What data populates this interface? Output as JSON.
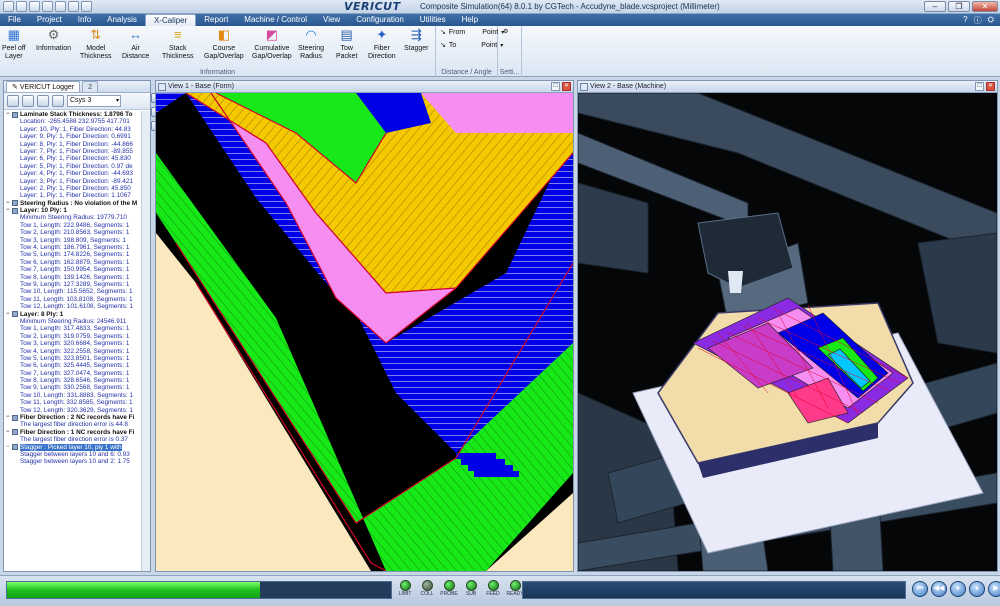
{
  "titlebar": {
    "logo": "VERICUT",
    "title": "Composite Simulation(64)  8.0.1 by CGTech - Accudyne_blade.vcsproject (Millimeter)",
    "controls": [
      "–",
      "❐",
      "✕"
    ]
  },
  "menu": {
    "items": [
      {
        "label": "File"
      },
      {
        "label": "Project"
      },
      {
        "label": "Info"
      },
      {
        "label": "Analysis"
      },
      {
        "label": "X-Caliper",
        "active": true
      },
      {
        "label": "Report"
      },
      {
        "label": "Machine / Control"
      },
      {
        "label": "View"
      },
      {
        "label": "Configuration"
      },
      {
        "label": "Utilities"
      },
      {
        "label": "Help"
      }
    ],
    "right": [
      "?",
      "ⓘ",
      "⛭"
    ]
  },
  "ribbon": {
    "buttons": [
      {
        "label": "Peel off\nLayer",
        "icon": "peel-off-icon"
      },
      {
        "label": "Information",
        "icon": "information-icon"
      },
      {
        "label": "Model\nThickness",
        "icon": "model-thickness-icon"
      },
      {
        "label": "Air\nDistance",
        "icon": "air-distance-icon"
      },
      {
        "label": "Stack\nThickness",
        "icon": "stack-thickness-icon"
      },
      {
        "label": "Course\nGap/Overlap",
        "icon": "course-gap-icon"
      },
      {
        "label": "Cumulative\nGap/Overlap",
        "icon": "cumulative-gap-icon"
      },
      {
        "label": "Steering\nRadius",
        "icon": "steering-radius-icon"
      },
      {
        "label": "Tow\nPacket",
        "icon": "tow-packet-icon"
      },
      {
        "label": "Fiber\nDirection",
        "icon": "fiber-direction-icon"
      },
      {
        "label": "Stagger",
        "icon": "stagger-icon"
      }
    ],
    "group_information": "Information",
    "from_label": "From",
    "to_label": "To",
    "from_mode": "Point",
    "to_mode": "Point",
    "group_distance": "Distance / Angle",
    "settings_label": "Setti..."
  },
  "logger": {
    "tab_label": "VERICUT Logger",
    "tab2_label": "2",
    "csys": "Csys 3",
    "lines": [
      {
        "text": "Laminate Stack Thickness: 1.8796 To",
        "level": 0,
        "type": "header",
        "toggle": "−"
      },
      {
        "text": "Location: -265.4588 232.9755 417.701",
        "level": 1,
        "type": "sub"
      },
      {
        "text": "Layer: 10, Ply: 1, Fiber Direction: 44.83",
        "level": 1,
        "type": "sub"
      },
      {
        "text": "Layer: 9, Ply: 1, Fiber Direction: 0.6991",
        "level": 1,
        "type": "sub"
      },
      {
        "text": "Layer: 8, Ply: 1, Fiber Direction: -44.866",
        "level": 1,
        "type": "sub"
      },
      {
        "text": "Layer: 7, Ply: 1, Fiber Direction: -89.855",
        "level": 1,
        "type": "sub"
      },
      {
        "text": "Layer: 6, Ply: 1, Fiber Direction: 45.830",
        "level": 1,
        "type": "sub"
      },
      {
        "text": "Layer: 5, Ply: 1, Fiber Direction: 0.97 de",
        "level": 1,
        "type": "sub"
      },
      {
        "text": "Layer: 4, Ply: 1, Fiber Direction: -44.693",
        "level": 1,
        "type": "sub"
      },
      {
        "text": "Layer: 3, Ply: 1, Fiber Direction: -89.421",
        "level": 1,
        "type": "sub"
      },
      {
        "text": "Layer: 2, Ply: 1, Fiber Direction: 45.850",
        "level": 1,
        "type": "sub"
      },
      {
        "text": "Layer: 1, Ply: 1, Fiber Direction: 1.1067",
        "level": 1,
        "type": "sub"
      },
      {
        "text": "Steering Radius : No violation of the M",
        "level": 0,
        "type": "header",
        "toggle": "−"
      },
      {
        "text": "Layer: 10 Ply: 1",
        "level": 0,
        "type": "header",
        "toggle": "−"
      },
      {
        "text": "Minimum Steering Radius: 19779.710",
        "level": 1,
        "type": "sub"
      },
      {
        "text": "Tow 1, Length: 222.9486, Segments: 1",
        "level": 1,
        "type": "sub"
      },
      {
        "text": "Tow 2, Length: 210.8563, Segments: 1",
        "level": 1,
        "type": "sub"
      },
      {
        "text": "Tow 3, Length: 198.809, Segments: 1",
        "level": 1,
        "type": "sub"
      },
      {
        "text": "Tow 4, Length: 186.7961, Segments: 1",
        "level": 1,
        "type": "sub"
      },
      {
        "text": "Tow 5, Length: 174.8226, Segments: 1",
        "level": 1,
        "type": "sub"
      },
      {
        "text": "Tow 6, Length: 162.8879, Segments: 1",
        "level": 1,
        "type": "sub"
      },
      {
        "text": "Tow 7, Length: 150.9954, Segments: 1",
        "level": 1,
        "type": "sub"
      },
      {
        "text": "Tow 8, Length: 139.1426, Segments: 1",
        "level": 1,
        "type": "sub"
      },
      {
        "text": "Tow 9, Length: 127.3289, Segments: 1",
        "level": 1,
        "type": "sub"
      },
      {
        "text": "Tow 10, Length: 115.5652, Segments: 1",
        "level": 1,
        "type": "sub"
      },
      {
        "text": "Tow 11, Length: 103.8108, Segments: 1",
        "level": 1,
        "type": "sub"
      },
      {
        "text": "Tow 12, Length: 101.6108, Segments: 1",
        "level": 1,
        "type": "sub"
      },
      {
        "text": "Layer: 8 Ply: 1",
        "level": 0,
        "type": "header",
        "toggle": "−"
      },
      {
        "text": "Minimum Steering Radius: 24546.911",
        "level": 1,
        "type": "sub"
      },
      {
        "text": "Tow 1, Length: 317.4833, Segments: 1",
        "level": 1,
        "type": "sub"
      },
      {
        "text": "Tow 2, Length: 319.0759, Segments: 1",
        "level": 1,
        "type": "sub"
      },
      {
        "text": "Tow 3, Length: 320.6684, Segments: 1",
        "level": 1,
        "type": "sub"
      },
      {
        "text": "Tow 4, Length: 322.2558, Segments: 1",
        "level": 1,
        "type": "sub"
      },
      {
        "text": "Tow 5, Length: 323.8501, Segments: 1",
        "level": 1,
        "type": "sub"
      },
      {
        "text": "Tow 6, Length: 325.4445, Segments: 1",
        "level": 1,
        "type": "sub"
      },
      {
        "text": "Tow 7, Length: 327.0474, Segments: 1",
        "level": 1,
        "type": "sub"
      },
      {
        "text": "Tow 8, Length: 328.6546, Segments: 1",
        "level": 1,
        "type": "sub"
      },
      {
        "text": "Tow 9, Length: 330.2568, Segments: 1",
        "level": 1,
        "type": "sub"
      },
      {
        "text": "Tow 10, Length: 331.8883, Segments: 1",
        "level": 1,
        "type": "sub"
      },
      {
        "text": "Tow 11, Length: 332.8585, Segments: 1",
        "level": 1,
        "type": "sub"
      },
      {
        "text": "Tow 12, Length: 320.3629, Segments: 1",
        "level": 1,
        "type": "sub"
      },
      {
        "text": "Fiber Direction : 2 NC records have Fi",
        "level": 0,
        "type": "header",
        "toggle": "−"
      },
      {
        "text": "The largest fiber direction error is 44.8",
        "level": 1,
        "type": "sub"
      },
      {
        "text": "Fiber Direction : 1 NC records have Fi",
        "level": 0,
        "type": "header",
        "toggle": "−"
      },
      {
        "text": "The largest fiber direction error is 0.37",
        "level": 1,
        "type": "sub"
      },
      {
        "text": "Stagger : Picked layer 10, ply 1 with",
        "level": 0,
        "type": "hl",
        "toggle": "−"
      },
      {
        "text": "Stagger between layers 10 and 6: 0.93",
        "level": 1,
        "type": "sub"
      },
      {
        "text": "Stagger between layers 10 and 2: 1.75",
        "level": 1,
        "type": "sub"
      }
    ]
  },
  "view1": {
    "title": "View 1 - Base (Form)"
  },
  "view2": {
    "title": "View 2 - Base (Machine)"
  },
  "status": {
    "progress": 0.66,
    "leds": [
      {
        "label": "LIMIT",
        "on": true
      },
      {
        "label": "COLL",
        "on": false
      },
      {
        "label": "PROBE",
        "on": true
      },
      {
        "label": "SUB",
        "on": true
      },
      {
        "label": "FEED",
        "on": true
      },
      {
        "label": "READY",
        "on": true
      }
    ],
    "playback": [
      "⏮",
      "◀◀",
      "⏸",
      "⏸",
      "▶"
    ]
  },
  "colors": {
    "ply_yellow": "#f5c800",
    "ply_pink": "#f58ef0",
    "ply_blue": "#0000e6",
    "ply_green": "#17e817",
    "ply_cream": "#fbe8bf",
    "ply_edge": "#d0002a"
  }
}
